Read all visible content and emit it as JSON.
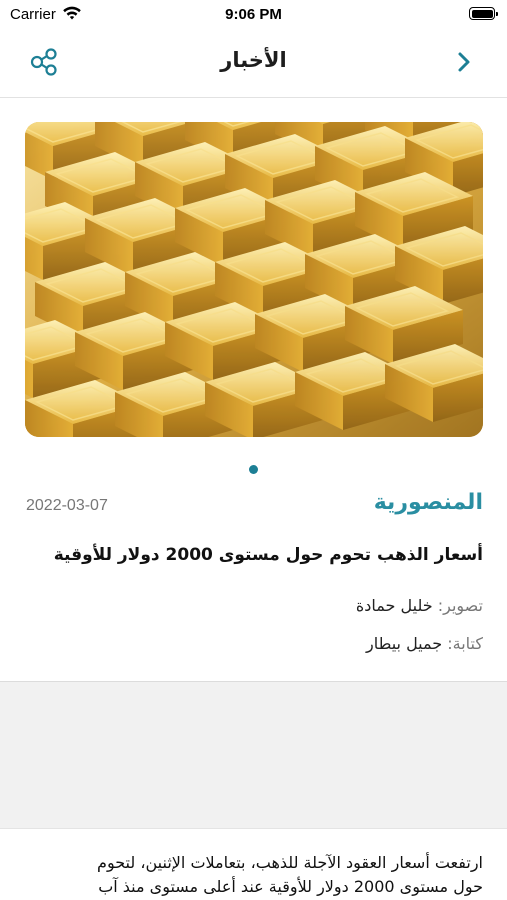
{
  "status_bar": {
    "carrier": "Carrier",
    "time": "9:06 PM"
  },
  "nav": {
    "title": "الأخبار",
    "share_icon": "share-nodes-icon",
    "back_icon": "chevron-right-icon",
    "accent_color": "#1d7f95"
  },
  "article": {
    "image_alt": "gold bars",
    "source": "المنصورية",
    "date": "2022-03-07",
    "headline": "أسعار الذهب تحوم حول مستوى 2000 دولار للأوقية",
    "photo_label": "تصوير:",
    "photo_by": "خليل حمادة",
    "writer_label": "كتابة:",
    "writer": "جميل بيطار",
    "body_line1": "ارتفعت أسعار العقود الآجلة للذهب، بتعاملات الإثنين، لتحوم",
    "body_line2": "حول مستوى 2000 دولار للأوقية عند أعلى مستوى منذ آب"
  },
  "pager": {
    "pages": 1,
    "current": 1
  }
}
